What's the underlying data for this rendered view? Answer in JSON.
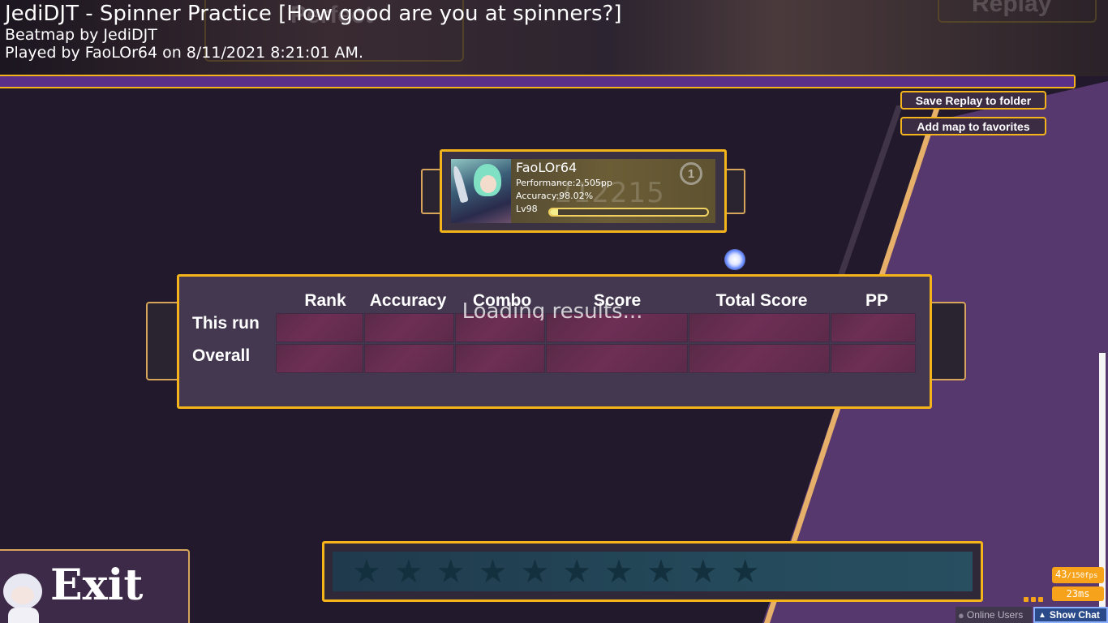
{
  "header": {
    "title": "JediDJT - Spinner Practice [How good are you at spinners?]",
    "mapper": "Beatmap by JediDJT",
    "played_by": "Played by FaoLOr64 on 8/11/2021 8:21:01 AM.",
    "ghost_left": "Perfect",
    "ghost_right": "Replay"
  },
  "progress": {
    "fraction": 1.0
  },
  "actions": {
    "save_replay": "Save Replay to folder",
    "add_favorite": "Add map to favorites"
  },
  "player": {
    "name": "FaoLOr64",
    "performance": "Performance:2,505pp",
    "accuracy": "Accuracy:98.02%",
    "level": "Lv98",
    "rank": "1",
    "ghost_score": "212215",
    "level_progress": 0.05
  },
  "results": {
    "columns": [
      "Rank",
      "Accuracy",
      "Combo",
      "Score",
      "Total Score",
      "PP"
    ],
    "rows": [
      "This run",
      "Overall"
    ],
    "loading": "Loading results..."
  },
  "stars": {
    "count": 10
  },
  "exit": {
    "label": "Exit"
  },
  "status": {
    "fps": "43",
    "fps_max": "/150fps",
    "latency": "23ms",
    "online_users": "Online Users",
    "show_chat": "Show Chat"
  },
  "colors": {
    "accent": "#f4b41a",
    "panel": "#43384f",
    "cell": "#6e2f55",
    "background": "#221a2c",
    "background_right": "#5a3a72"
  }
}
